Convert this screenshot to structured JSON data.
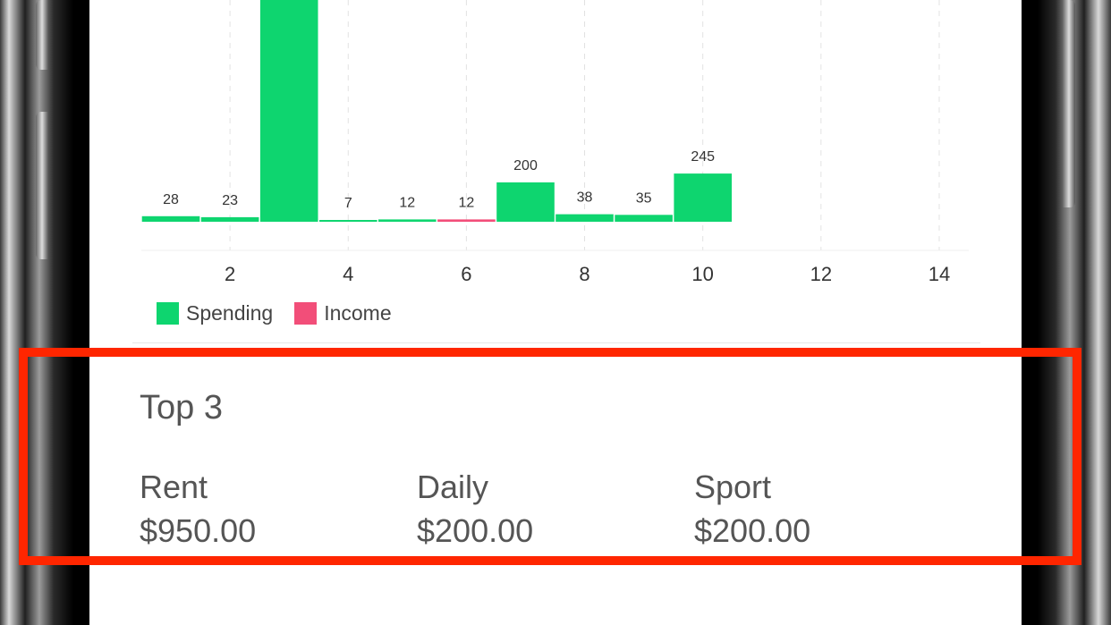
{
  "chart_data": {
    "type": "bar",
    "x": [
      1,
      2,
      3,
      4,
      5,
      6,
      7,
      8,
      9,
      10
    ],
    "values": [
      28,
      23,
      950,
      7,
      12,
      12,
      200,
      38,
      35,
      245
    ],
    "value_labels": [
      "28",
      "23",
      "",
      "7",
      "12",
      "12",
      "200",
      "38",
      "35",
      "245"
    ],
    "bar_kinds": [
      "spending",
      "spending",
      "spending",
      "spending",
      "spending",
      "income",
      "spending",
      "spending",
      "spending",
      "spending"
    ],
    "xticks": [
      2,
      4,
      6,
      8,
      10,
      12,
      14
    ],
    "xlim": [
      0.5,
      14.5
    ],
    "grid": "vertical dashed"
  },
  "legend": {
    "spending": "Spending",
    "income": "Income"
  },
  "colors": {
    "spending": "#0ed56f",
    "income": "#f24e79",
    "highlight": "#ff2600"
  },
  "top3": {
    "title": "Top 3",
    "items": [
      {
        "name": "Rent",
        "amount": "$950.00"
      },
      {
        "name": "Daily",
        "amount": "$200.00"
      },
      {
        "name": "Sport",
        "amount": "$200.00"
      }
    ]
  }
}
